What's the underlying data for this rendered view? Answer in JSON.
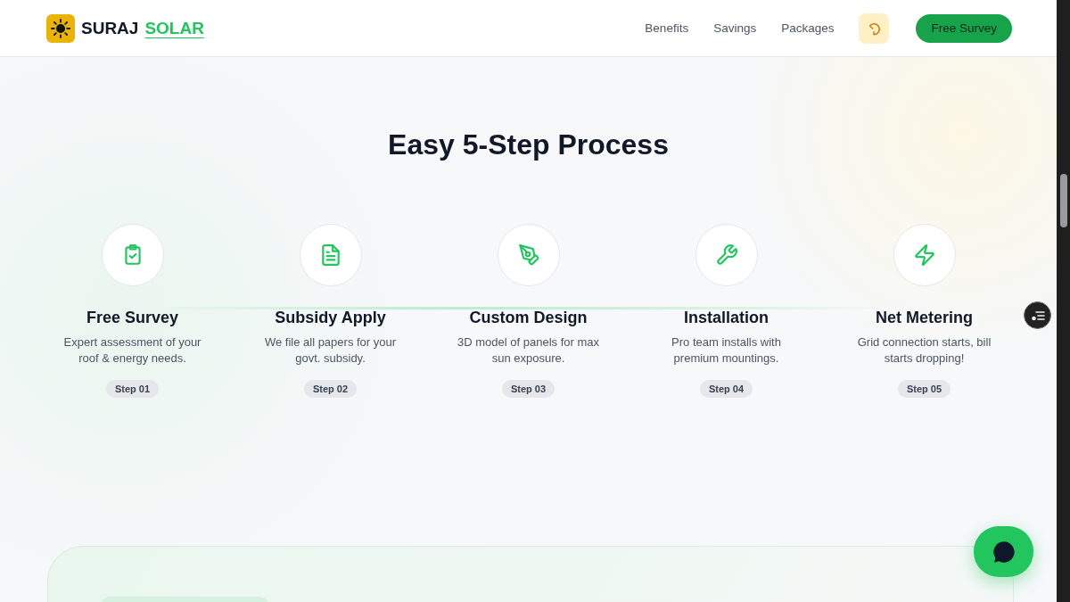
{
  "header": {
    "brand": {
      "first": "SURAJ",
      "second": "SOLAR"
    },
    "nav": [
      "Benefits",
      "Savings",
      "Packages"
    ],
    "cta": "Free Survey"
  },
  "section": {
    "title": "Easy 5-Step Process",
    "steps": [
      {
        "title": "Free Survey",
        "text": "Expert assessment of your roof & energy needs.",
        "badge": "Step 01"
      },
      {
        "title": "Subsidy Apply",
        "text": "We file all papers for your govt. subsidy.",
        "badge": "Step 02"
      },
      {
        "title": "Custom Design",
        "text": "3D model of panels for max sun exposure.",
        "badge": "Step 03"
      },
      {
        "title": "Installation",
        "text": "Pro team installs with premium mountings.",
        "badge": "Step 04"
      },
      {
        "title": "Net Metering",
        "text": "Grid connection starts, bill starts dropping!",
        "badge": "Step 05"
      }
    ]
  }
}
